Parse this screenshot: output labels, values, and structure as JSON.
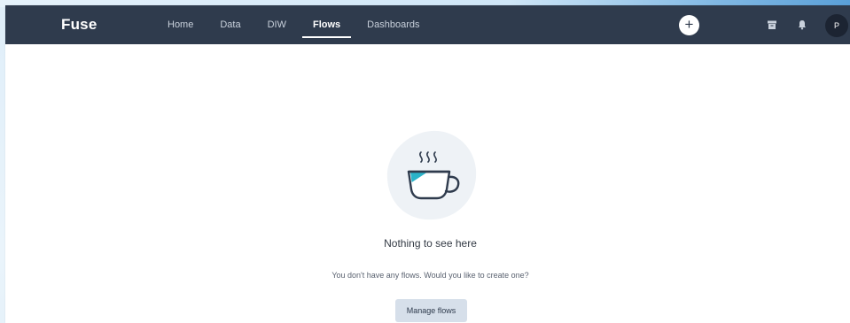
{
  "navbar": {
    "brand": "Fuse",
    "tabs": [
      {
        "label": "Home",
        "active": false
      },
      {
        "label": "Data",
        "active": false
      },
      {
        "label": "DIW",
        "active": false
      },
      {
        "label": "Flows",
        "active": true
      },
      {
        "label": "Dashboards",
        "active": false
      }
    ],
    "plus_label": "+",
    "icons": [
      "archive-icon",
      "bell-icon"
    ],
    "avatar_initial": "P"
  },
  "empty_state": {
    "illustration": "coffee-cup-icon",
    "title": "Nothing to see here",
    "subtitle": "You don't have any flows. Would you like to create one?",
    "button_label": "Manage flows"
  },
  "colors": {
    "navbar_bg": "#2f3b4d",
    "accent_teal": "#2bb3c9",
    "button_bg": "#d6dfea"
  }
}
